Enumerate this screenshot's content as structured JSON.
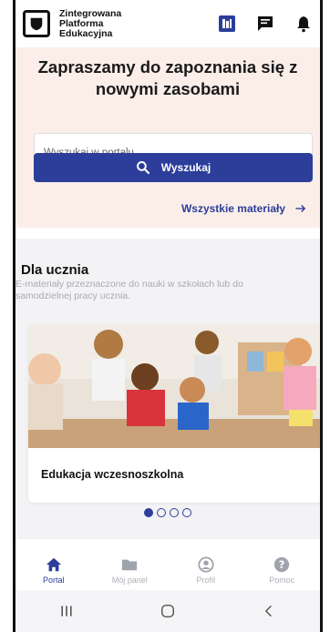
{
  "header": {
    "brand_line1": "Zintegrowana",
    "brand_line2": "Platforma",
    "brand_line3": "Edukacyjna",
    "icons": [
      "logo-icon",
      "library-icon",
      "message-icon",
      "bell-icon"
    ]
  },
  "hero": {
    "title": "Zapraszamy do zapoznania się z nowymi zasobami",
    "search_placeholder": "Wyszukaj w portalu",
    "search_button": "Wyszukaj",
    "all_materials_link": "Wszystkie materiały"
  },
  "section": {
    "title": "Dla ucznia",
    "description": "E-materiały przeznaczone do nauki w szkołach lub do samodzielnej pracy ucznia.",
    "card_title": "Edukacja wczesnoszkolna",
    "carousel_count": 4,
    "carousel_active": 0
  },
  "bottom_nav": {
    "items": [
      {
        "label": "Portal",
        "icon": "home-icon",
        "active": true
      },
      {
        "label": "Mój panel",
        "icon": "folder-icon",
        "active": false
      },
      {
        "label": "Profil",
        "icon": "user-icon",
        "active": false
      },
      {
        "label": "Pomoc",
        "icon": "help-icon",
        "active": false
      }
    ]
  },
  "colors": {
    "primary": "#2c3e9a",
    "hero_bg": "#fbeee9",
    "section_bg": "#f3f3f5"
  }
}
